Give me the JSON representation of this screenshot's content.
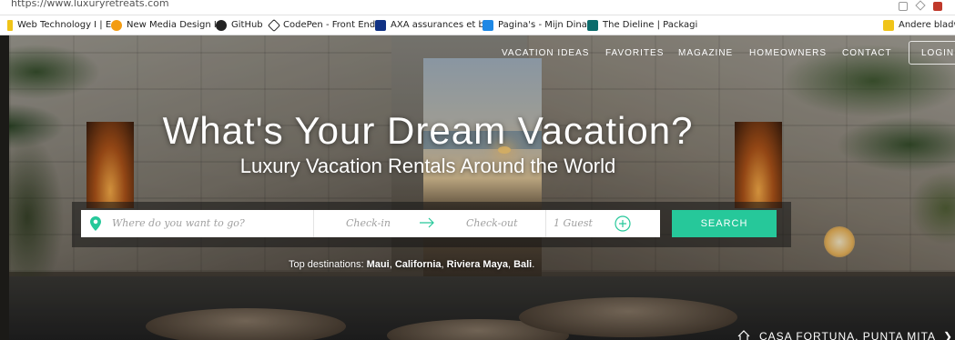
{
  "browser": {
    "url": "https://www.luxuryretreats.com",
    "bookmarks": [
      {
        "label": "Web Technology I | E",
        "icon": "folder-icon"
      },
      {
        "label": "New Media Design I",
        "icon": "orange-circle-icon"
      },
      {
        "label": "GitHub",
        "icon": "github-icon"
      },
      {
        "label": "CodePen - Front End",
        "icon": "codepen-icon"
      },
      {
        "label": "AXA assurances et ba",
        "icon": "axa-icon"
      },
      {
        "label": "Pagina's - Mijn Dinar",
        "icon": "pagina-icon"
      },
      {
        "label": "The Dieline | Packagi",
        "icon": "dieline-icon"
      },
      {
        "label": "Andere bladwij",
        "icon": "folder-icon"
      }
    ]
  },
  "nav": {
    "items": [
      "VACATION IDEAS",
      "FAVORITES",
      "MAGAZINE",
      "HOMEOWNERS",
      "CONTACT"
    ],
    "login": "LOGIN"
  },
  "hero": {
    "headline": "What's Your Dream Vacation?",
    "subheadline": "Luxury Vacation Rentals Around the World"
  },
  "search": {
    "destination_placeholder": "Where do you want to go?",
    "checkin_placeholder": "Check-in",
    "checkout_placeholder": "Check-out",
    "guests": "1 Guest",
    "button": "SEARCH"
  },
  "top_destinations": {
    "label": "Top destinations:",
    "places": [
      "Maui",
      "California",
      "Riviera Maya",
      "Bali"
    ]
  },
  "property_caption": "CASA FORTUNA, PUNTA MITA",
  "colors": {
    "accent": "#26c89a",
    "white": "#ffffff"
  }
}
